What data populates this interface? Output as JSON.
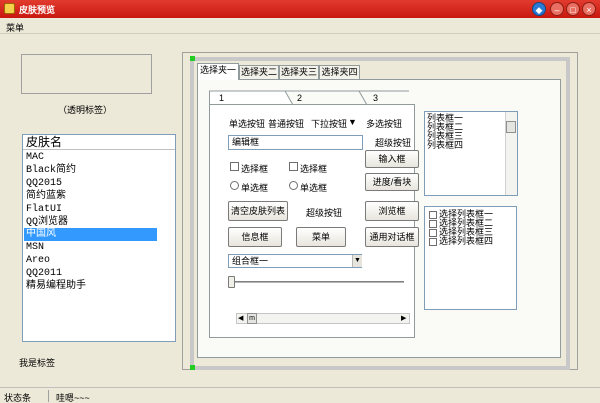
{
  "window": {
    "title": "皮肤预览"
  },
  "menu": {
    "label": "菜单"
  },
  "left": {
    "transparent_label": "（透明标签）",
    "list_header": "皮肤名",
    "skins": [
      "MAC",
      "Black简约",
      "QQ2015",
      "简约蓝紫",
      "FlatUI",
      "QQ浏览器",
      "中国风",
      "MSN",
      "Areo",
      "QQ2011",
      "精易编程助手"
    ],
    "selected_skin": "中国风",
    "bottom_label": "我是标签"
  },
  "outer_tabs": [
    "选择夹一",
    "选择夹二",
    "选择夹三",
    "选择夹四"
  ],
  "inner_tabs": [
    "1",
    "2",
    "3"
  ],
  "controls": {
    "radio_button_label": "单选按钮",
    "normal_button_label": "普通按钮",
    "dropdown_button_label": "下拉按钮",
    "multi_select_button_label": "多选按钮",
    "super_button_label": "超级按钮",
    "edit_value": "编辑框",
    "input_box_label": "输入框",
    "progress_label": "进度/看块",
    "checkbox1_label": "选择框",
    "checkbox2_label": "选择框",
    "radio1_label": "单选框",
    "radio2_label": "单选框",
    "clear_skin_list_label": "清空皮肤列表",
    "super_button2_label": "超级按钮",
    "browse_label": "浏览框",
    "info_box_label": "信息框",
    "menu_button_label": "菜单",
    "common_dialog_label": "通用对话框",
    "combo_value": "组合框一",
    "scroll_thumb_label": "m"
  },
  "list_box": {
    "items": [
      "列表框一",
      "列表框二",
      "列表框三",
      "列表框四"
    ]
  },
  "check_list_box": {
    "items": [
      "选择列表框一",
      "选择列表框二",
      "选择列表框三",
      "选择列表框四"
    ]
  },
  "status": {
    "left": "状态条",
    "right": "哇嗯~~~"
  }
}
